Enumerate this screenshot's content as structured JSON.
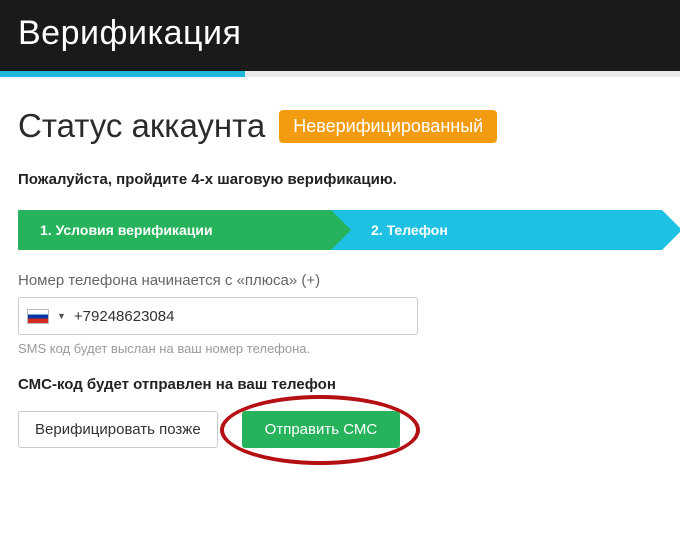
{
  "header": {
    "title": "Верификация"
  },
  "status": {
    "title": "Статус аккаунта",
    "badge": "Неверифицированный"
  },
  "instruction": "Пожалуйста, пройдите 4-х шаговую верификацию.",
  "steps": {
    "step1": "1. Условия верификации",
    "step2": "2. Телефон"
  },
  "phone": {
    "label": "Номер телефона начинается с «плюса» (+)",
    "value": "+79248623084",
    "hint": "SMS код будет выслан на ваш номер телефона."
  },
  "sub_instruction": "СМС-код будет отправлен на ваш телефон",
  "actions": {
    "later": "Верифицировать позже",
    "send": "Отправить СМС"
  }
}
